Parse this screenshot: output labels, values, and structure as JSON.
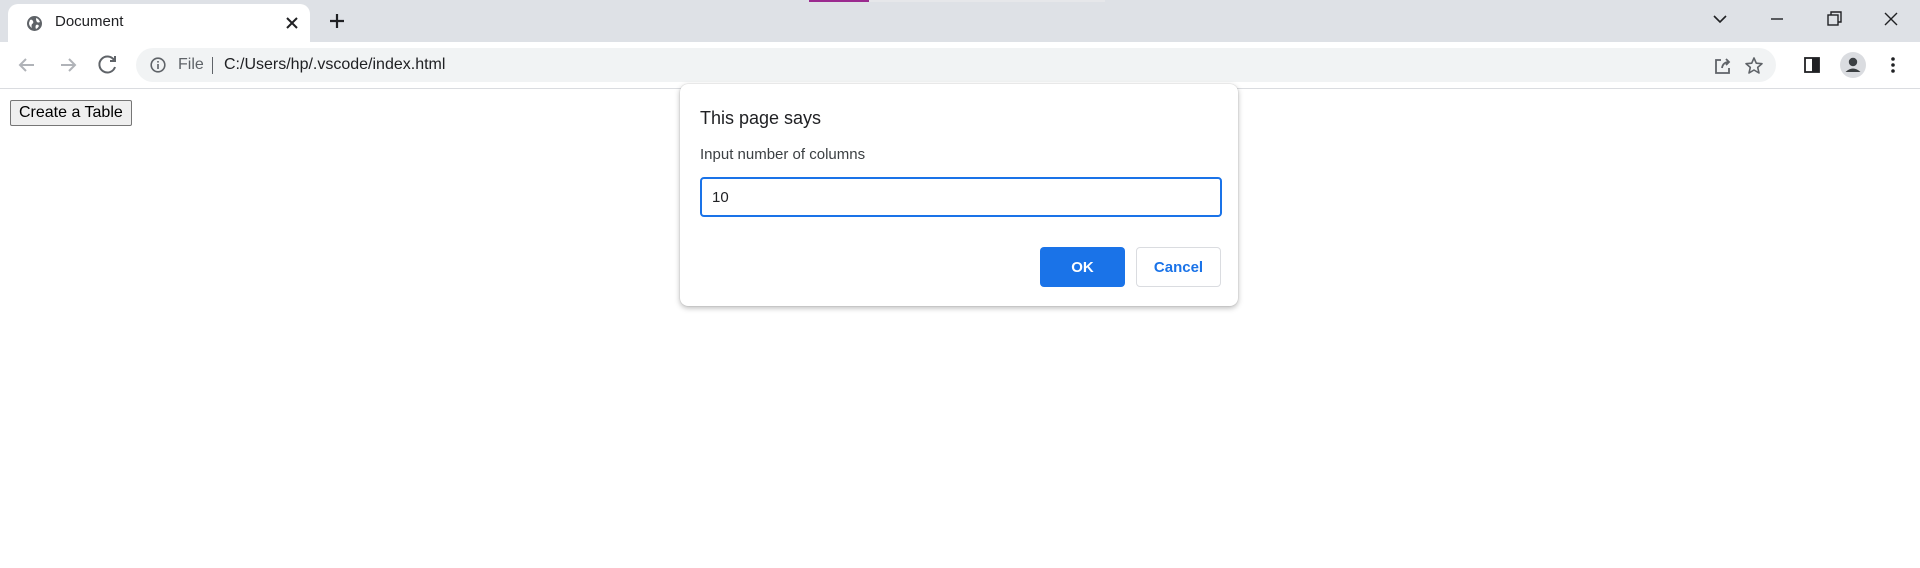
{
  "browser": {
    "tab": {
      "title": "Document",
      "favicon": "globe-icon"
    },
    "toolbar": {
      "scheme_label": "File",
      "url": "C:/Users/hp/.vscode/index.html"
    },
    "icons": {
      "close": "close-icon",
      "new_tab": "plus-icon",
      "back": "back-arrow-icon",
      "forward": "forward-arrow-icon",
      "reload": "reload-icon",
      "info": "info-icon",
      "share": "share-icon",
      "bookmark": "star-icon",
      "side_panel": "side-panel-icon",
      "profile": "avatar-icon",
      "menu": "kebab-menu-icon",
      "tab_search": "chevron-down-icon",
      "minimize": "minimize-icon",
      "restore": "restore-icon",
      "window_close": "close-icon"
    }
  },
  "page": {
    "button_label": "Create a Table"
  },
  "dialog": {
    "title": "This page says",
    "message": "Input number of columns",
    "input_value": "10",
    "ok_label": "OK",
    "cancel_label": "Cancel"
  },
  "colors": {
    "accent": "#1a73e8",
    "tabstrip_bg": "#dee1e6",
    "omnibox_bg": "#f1f3f4"
  }
}
